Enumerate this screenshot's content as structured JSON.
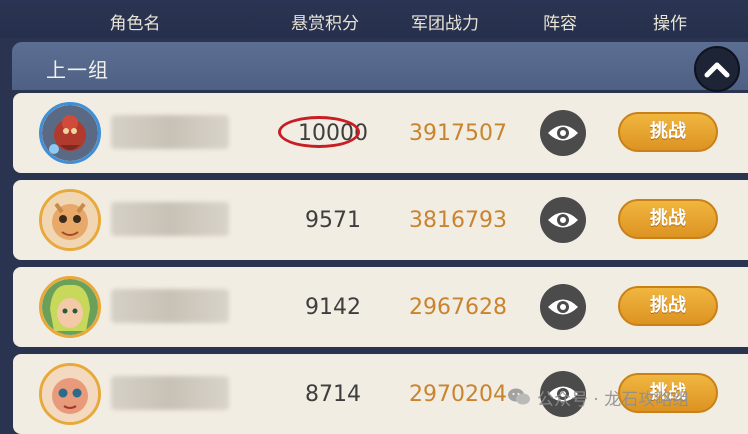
{
  "header": {
    "columns": [
      "角色名",
      "悬赏积分",
      "军团战力",
      "阵容",
      "操作"
    ]
  },
  "group": {
    "title": "上一组",
    "collapse_icon": "chevron-up-icon"
  },
  "rows": [
    {
      "score": "10000",
      "power": "3917507",
      "challenge_label": "挑战",
      "highlighted": true
    },
    {
      "score": "9571",
      "power": "3816793",
      "challenge_label": "挑战"
    },
    {
      "score": "9142",
      "power": "2967628",
      "challenge_label": "挑战"
    },
    {
      "score": "8714",
      "power": "2970204",
      "challenge_label": "挑战"
    }
  ],
  "watermark": {
    "icon": "wechat-icon",
    "text": "公众号 · 龙石攻略组"
  },
  "colors": {
    "background": "#2a3450",
    "row": "#f2ede3",
    "power_text": "#c8842e",
    "challenge_button": "#e8a32e",
    "highlight_ring": "#c81d25"
  }
}
